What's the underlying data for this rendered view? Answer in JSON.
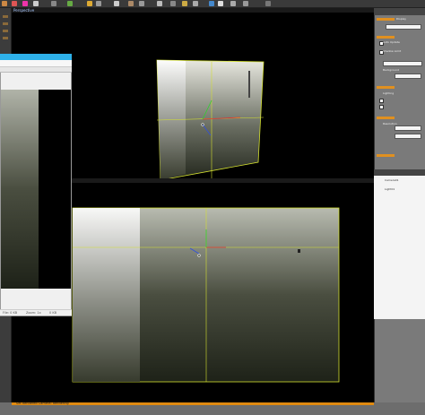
{
  "app": {
    "viewport_top_title": "Perspective",
    "viewport_bottom_label": "",
    "status_text": "Set Rendered Camera: Rendering"
  },
  "floating_window": {
    "status": [
      "File: 0 KB",
      "Zoom: 1x",
      "0 KB"
    ]
  },
  "right_panel": {
    "labels": [
      "Display",
      "Auto Update",
      "Shadow Limit",
      "Background",
      "Lighting",
      "Resolution"
    ],
    "list_items": [
      "Camera01",
      "Light01"
    ]
  },
  "colors": {
    "accent": "#e08a10",
    "title_bar": "#2eb1ea",
    "gizmo_yellow": "#d4e030",
    "gizmo_red": "#e03030",
    "gizmo_green": "#30d030",
    "gizmo_blue": "#3050e0"
  }
}
